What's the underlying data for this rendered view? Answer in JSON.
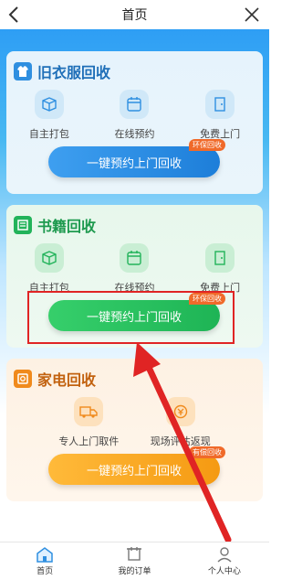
{
  "header": {
    "title": "首页"
  },
  "cards": [
    {
      "title": "旧衣服回收",
      "features": [
        {
          "label": "自主打包",
          "icon": "box-icon"
        },
        {
          "label": "在线预约",
          "icon": "calendar-icon"
        },
        {
          "label": "免费上门",
          "icon": "door-icon"
        }
      ],
      "cta": "一键预约上门回收",
      "badge": "环保回收"
    },
    {
      "title": "书籍回收",
      "features": [
        {
          "label": "自主打包",
          "icon": "box-icon"
        },
        {
          "label": "在线预约",
          "icon": "calendar-icon"
        },
        {
          "label": "免费上门",
          "icon": "door-icon"
        }
      ],
      "cta": "一键预约上门回收",
      "badge": "环保回收"
    },
    {
      "title": "家电回收",
      "features": [
        {
          "label": "专人上门取件",
          "icon": "truck-icon"
        },
        {
          "label": "现场评估返现",
          "icon": "money-icon"
        }
      ],
      "cta": "一键预约上门回收",
      "badge": "有偿回收"
    }
  ],
  "tabs": [
    {
      "label": "首页",
      "icon": "home-icon"
    },
    {
      "label": "我的订单",
      "icon": "order-icon"
    },
    {
      "label": "个人中心",
      "icon": "user-icon"
    }
  ],
  "colors": {
    "blue_accent": "#1d7ed9",
    "green_accent": "#1eb455",
    "orange_accent": "#f59a12",
    "highlight": "#e02424"
  }
}
